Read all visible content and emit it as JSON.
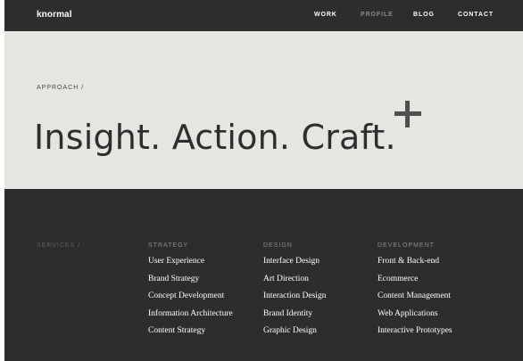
{
  "header": {
    "logo": "knormal",
    "nav": [
      {
        "label": "WORK",
        "active": false
      },
      {
        "label": "PROFILE",
        "active": true
      },
      {
        "label": "BLOG",
        "active": false
      },
      {
        "label": "CONTACT",
        "active": false
      }
    ]
  },
  "hero": {
    "breadcrumb": "APPROACH /",
    "headline": "Insight. Action. Craft.",
    "icon": "plus-icon"
  },
  "services": {
    "label": "SERVICES /",
    "columns": [
      {
        "heading": "STRATEGY",
        "items": [
          "User Experience",
          "Brand Strategy",
          "Concept Development",
          "Information Architecture",
          "Content Strategy"
        ]
      },
      {
        "heading": "DESIGN",
        "items": [
          "Interface Design",
          "Art Direction",
          "Interaction Design",
          "Brand Identity",
          "Graphic Design"
        ]
      },
      {
        "heading": "DEVELOPMENT",
        "items": [
          "Front & Back-end",
          "Ecommerce",
          "Content Management",
          "Web Applications",
          "Interactive Prototypes"
        ]
      }
    ]
  },
  "colors": {
    "dark": "#2d2d2d",
    "light": "#e6e5e1",
    "muted": "#8c8b87"
  }
}
